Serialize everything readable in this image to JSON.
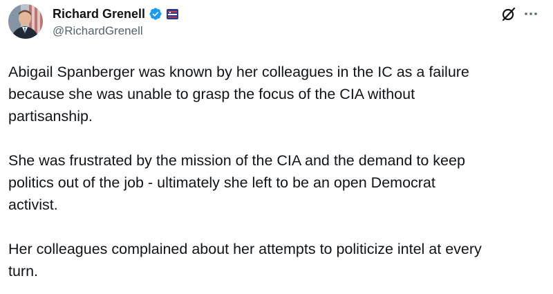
{
  "author": {
    "display_name": "Richard Grenell",
    "handle": "@RichardGrenell",
    "verified_icon": "verified-badge-icon",
    "affiliation_icon": "affiliation-badge-icon",
    "verified_color": "#1d9bf0"
  },
  "actions": {
    "grok_icon": "grok-icon",
    "more_icon": "more-options-icon"
  },
  "post": {
    "paragraphs": [
      "Abigail Spanberger was known by her colleagues in the IC as a failure\nbecause she was unable to grasp the focus of the CIA without\npartisanship.",
      "She was frustrated by the mission of the CIA and the demand to keep\npolitics out of the job - ultimately she left to be an open Democrat\nactivist.",
      "Her colleagues complained about her attempts to politicize intel at every\nturn."
    ]
  }
}
